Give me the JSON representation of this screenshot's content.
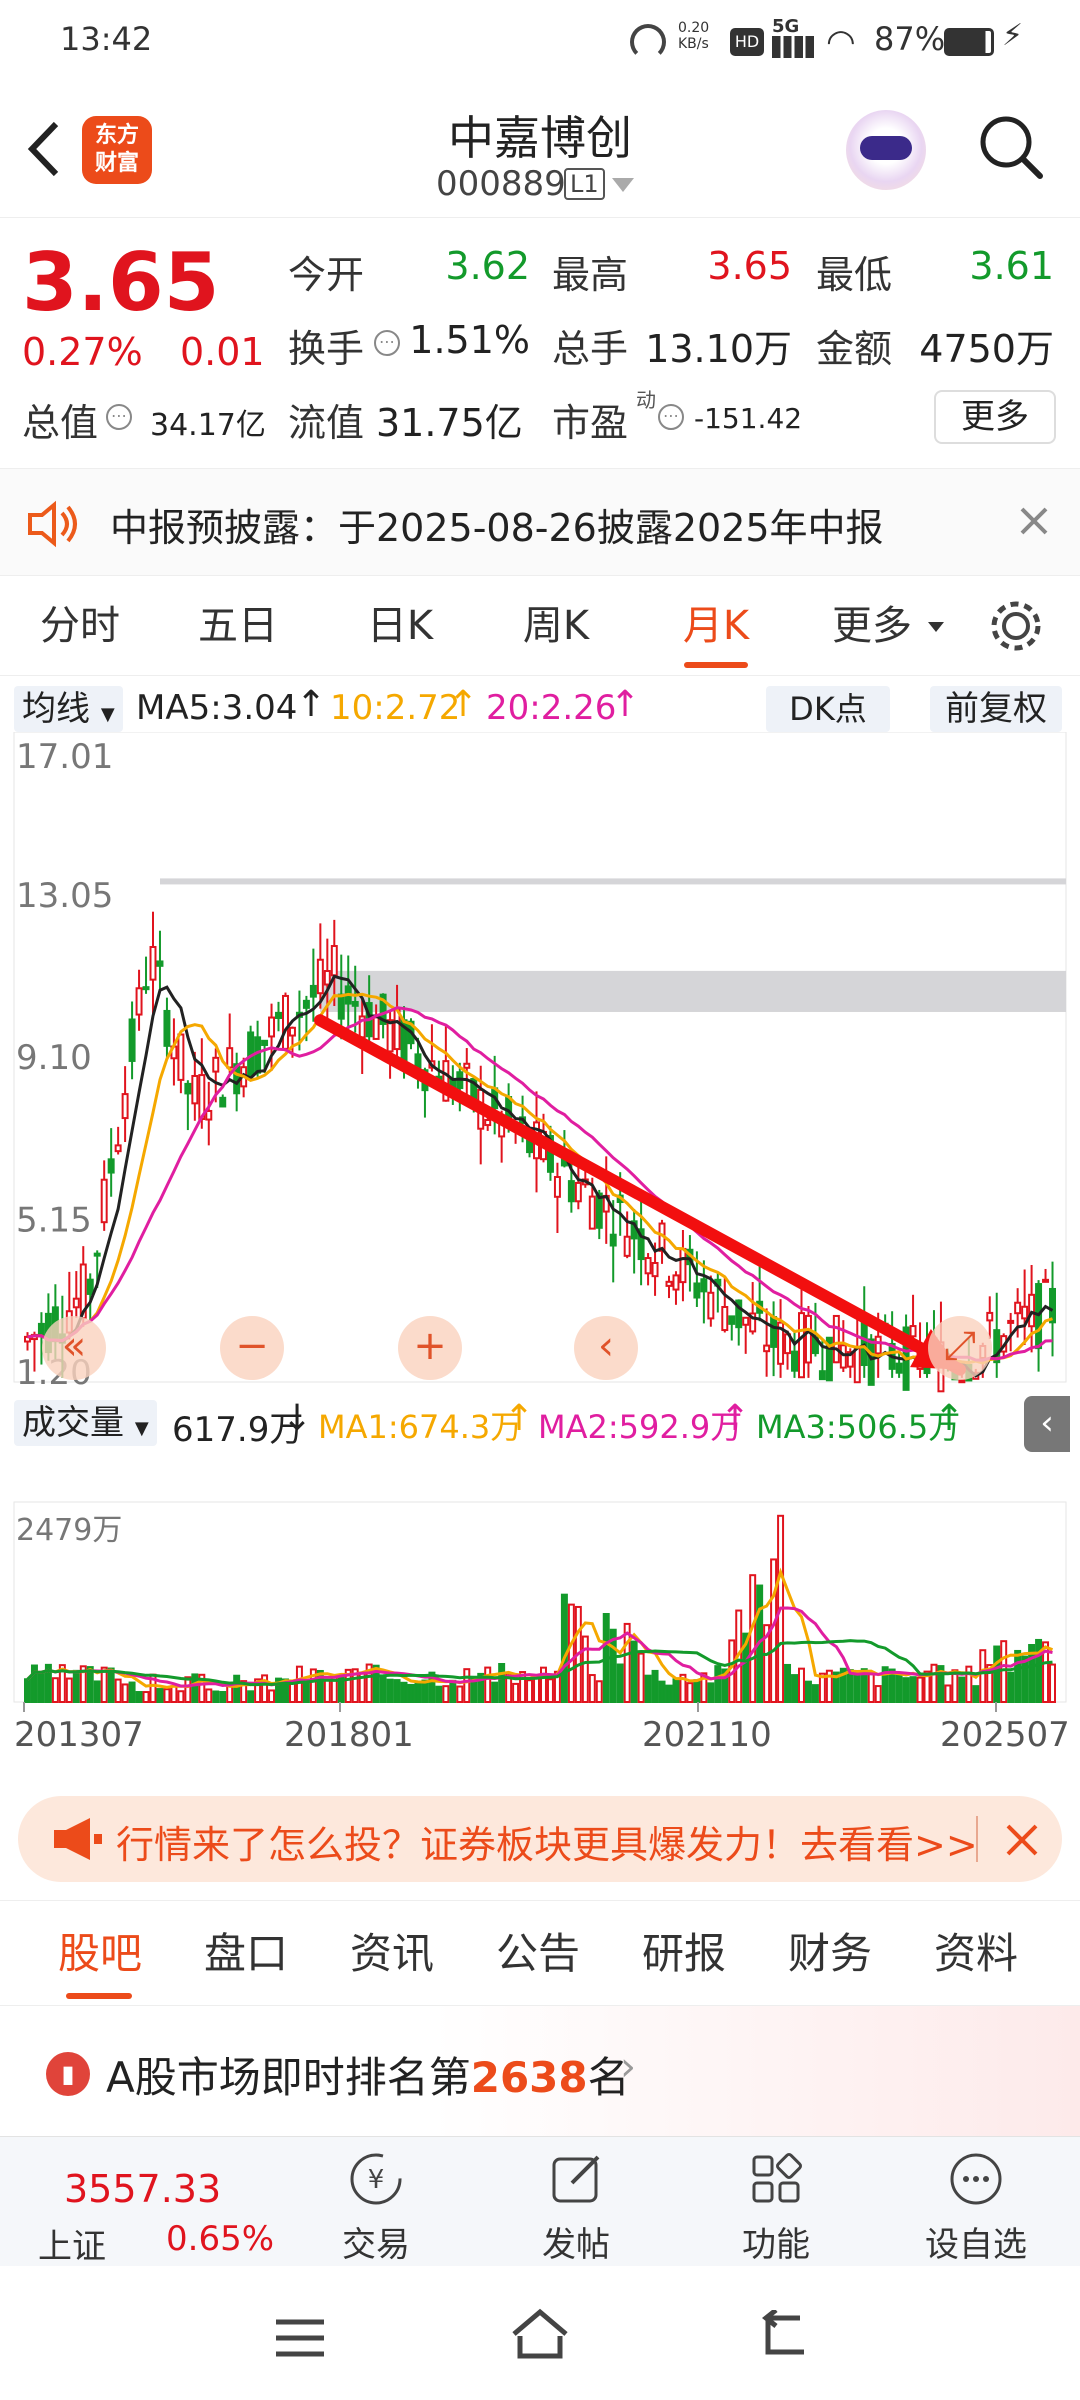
{
  "status": {
    "time": "13:42",
    "net_speed": "0.20\nKB/s",
    "hd": "HD",
    "signal": "5G",
    "battery": "87%"
  },
  "nav": {
    "logo": "东方\n财富",
    "title": "中嘉博创",
    "code": "000889",
    "level": "L1"
  },
  "quote": {
    "price": "3.65",
    "change_pct": "0.27%",
    "change": "0.01",
    "open_label": "今开",
    "open": "3.62",
    "high_label": "最高",
    "high": "3.65",
    "low_label": "最低",
    "low": "3.61",
    "turnover_label": "换手",
    "turnover": "1.51%",
    "vol_label": "总手",
    "vol": "13.10万",
    "amount_label": "金额",
    "amount": "4750万",
    "mcap_label": "总值",
    "mcap": "34.17亿",
    "float_label": "流值",
    "float": "31.75亿",
    "pe_label": "市盈",
    "pe_sup": "动",
    "pe": "-151.42",
    "more": "更多"
  },
  "notice": {
    "text": "中报预披露：于2025-08-26披露2025年中报"
  },
  "tabs": {
    "items": [
      "分时",
      "五日",
      "日K",
      "周K",
      "月K",
      "更多"
    ],
    "active": 4
  },
  "chart": {
    "ma_select": "均线",
    "ma5": "MA5:3.04",
    "ma10": "10:2.72",
    "ma20": "20:2.26",
    "dk": "DK点",
    "fq": "前复权",
    "y_labels": [
      "17.01",
      "13.05",
      "9.10",
      "5.15",
      "1.20"
    ],
    "vol_select": "成交量",
    "vol_now": "617.9万",
    "vol_ma1": "MA1:674.3万",
    "vol_ma2": "MA2:592.9万",
    "vol_ma3": "MA3:506.5万",
    "vol_max": "2479万",
    "x_labels": [
      "201307",
      "201801",
      "202110",
      "202507"
    ],
    "colors": {
      "up": "#e0141e",
      "down": "#139a2b",
      "ma5": "#222222",
      "ma10": "#f5a800",
      "ma20": "#e01ea0"
    }
  },
  "chart_data": {
    "type": "candlestick",
    "title": "",
    "ylim": [
      1.2,
      17.01
    ],
    "price_ticks": [
      17.01,
      13.05,
      9.1,
      5.15,
      1.2
    ],
    "x_ticks": [
      "201307",
      "201801",
      "202110",
      "202507"
    ],
    "ma": {
      "MA5": 3.04,
      "MA10": 2.72,
      "MA20": 2.26
    },
    "volume_ma": {
      "MA1": "674.3万",
      "MA2": "592.9万",
      "MA3": "506.5万"
    },
    "volume_last": "617.9万",
    "volume_max": "2479万",
    "trend_arrow": {
      "from": {
        "date": "201801",
        "price": 10.0
      },
      "to": {
        "date": "202507",
        "price": 1.5
      },
      "color": "#f20f0f"
    }
  },
  "banner": {
    "text": "行情来了怎么投？证券板块更具爆发力！去看看>>"
  },
  "lowtabs": {
    "items": [
      "股吧",
      "盘口",
      "资讯",
      "公告",
      "研报",
      "财务",
      "资料"
    ],
    "active": 0
  },
  "rank": {
    "prefix": "A股市场即时排名第",
    "num": "2638",
    "suffix": "名"
  },
  "bottom": {
    "index_val": "3557.33",
    "index_name": "上证",
    "index_pct": "0.65%",
    "items": [
      "交易",
      "发帖",
      "功能",
      "设自选"
    ]
  }
}
